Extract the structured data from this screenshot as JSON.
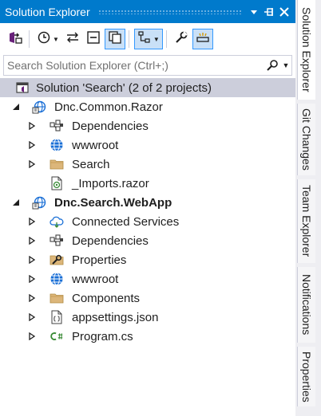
{
  "window": {
    "title": "Solution Explorer",
    "pin_tooltip": "Auto Hide",
    "close_tooltip": "Close"
  },
  "toolbar": {
    "items": [
      {
        "name": "switch-views-icon"
      },
      {
        "name": "history-icon"
      },
      {
        "name": "sync-with-document-icon"
      },
      {
        "name": "collapse-all-icon"
      },
      {
        "name": "show-all-files-icon"
      },
      {
        "name": "file-nesting-icon"
      },
      {
        "name": "properties-icon"
      },
      {
        "name": "preview-selected-items-icon"
      }
    ]
  },
  "search": {
    "placeholder": "Search Solution Explorer (Ctrl+;)"
  },
  "tree": {
    "solution": "Solution 'Search' (2 of 2 projects)",
    "project1": "Dnc.Common.Razor",
    "p1_dependencies": "Dependencies",
    "p1_wwwroot": "wwwroot",
    "p1_search": "Search",
    "p1_imports": "_Imports.razor",
    "project2": "Dnc.Search.WebApp",
    "p2_connected": "Connected Services",
    "p2_dependencies": "Dependencies",
    "p2_properties": "Properties",
    "p2_wwwroot": "wwwroot",
    "p2_components": "Components",
    "p2_appsettings": "appsettings.json",
    "p2_program": "Program.cs"
  },
  "side_tabs": {
    "solution_explorer": "Solution Explorer",
    "git_changes": "Git Changes",
    "team_explorer": "Team Explorer",
    "notifications": "Notifications",
    "properties": "Properties"
  },
  "colors": {
    "title_bar": "#007acc",
    "selection": "#cccedb",
    "folder": "#dcb67a",
    "globe": "#1a6fd6",
    "csharp": "#388a34"
  }
}
